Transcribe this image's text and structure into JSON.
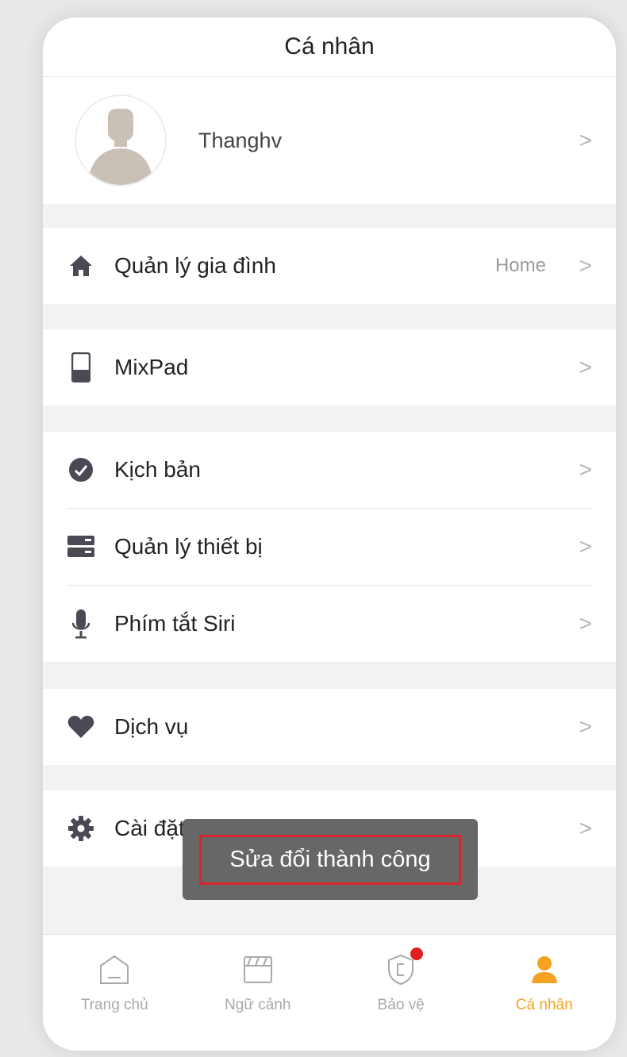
{
  "header": {
    "title": "Cá nhân"
  },
  "profile": {
    "name": "Thanghv"
  },
  "menu": {
    "family": {
      "label": "Quản lý gia đình",
      "value": "Home"
    },
    "mixpad": {
      "label": "MixPad"
    },
    "scenario": {
      "label": "Kịch bản"
    },
    "devices": {
      "label": "Quản lý thiết bị"
    },
    "siri": {
      "label": "Phím tắt Siri"
    },
    "service": {
      "label": "Dịch vụ"
    },
    "settings": {
      "label": "Cài đặt"
    }
  },
  "chevron": ">",
  "toast": {
    "message": "Sửa đổi thành công"
  },
  "tabs": [
    {
      "label": "Trang chủ",
      "icon": "home-icon"
    },
    {
      "label": "Ngữ cảnh",
      "icon": "scene-icon"
    },
    {
      "label": "Bảo vệ",
      "icon": "shield-icon"
    },
    {
      "label": "Cá nhân",
      "icon": "person-icon"
    }
  ],
  "colors": {
    "accent": "#f3a321",
    "badge": "#e02020",
    "icon": "#4a4a55"
  }
}
